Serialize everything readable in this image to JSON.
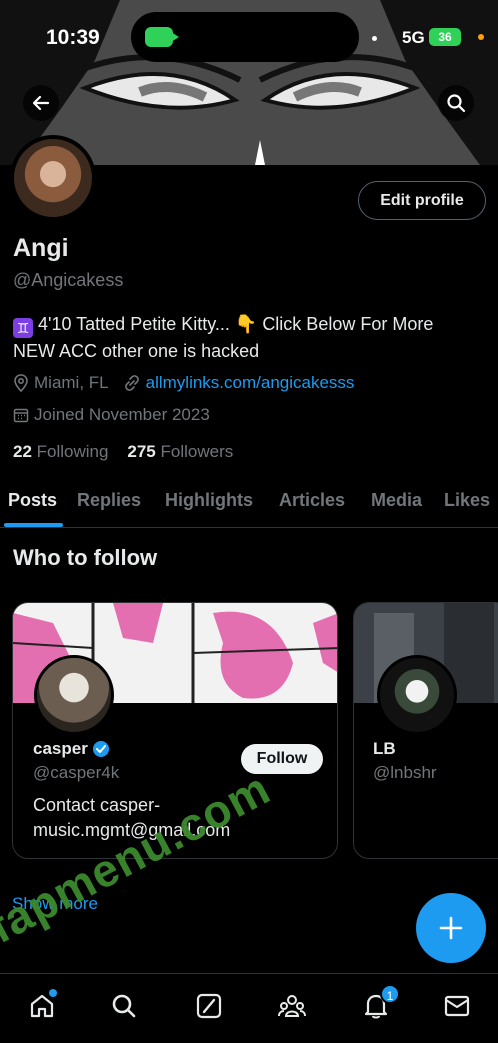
{
  "status_bar": {
    "time": "10:39",
    "network": "5G",
    "battery": "36"
  },
  "profile": {
    "edit_button": "Edit profile",
    "name": "Angi",
    "handle": "@Angicakess",
    "bio_emoji": "♊",
    "bio_line1": "4'10 Tatted Petite Kitty... 👇 Click Below For More",
    "bio_line2": "NEW ACC other one is hacked",
    "location": "Miami, FL",
    "link": "allmylinks.com/angicakesss",
    "joined": "Joined November 2023",
    "following_count": "22",
    "following_label": "Following",
    "followers_count": "275",
    "followers_label": "Followers"
  },
  "tabs": [
    "Posts",
    "Replies",
    "Highlights",
    "Articles",
    "Media",
    "Likes"
  ],
  "who_to_follow": {
    "title": "Who to follow",
    "cards": [
      {
        "name": "casper",
        "handle": "@casper4k",
        "bio": "Contact casper­music.mgmt@gmail.com",
        "follow_label": "Follow"
      },
      {
        "name": "LB",
        "handle": "@lnbshr"
      }
    ],
    "show_more": "Show more"
  },
  "watermark": "fapmenu.com",
  "nav": {
    "notification_badge": "1"
  },
  "colors": {
    "accent": "#1d9bf0",
    "background": "#000000",
    "muted_text": "#71767b"
  }
}
